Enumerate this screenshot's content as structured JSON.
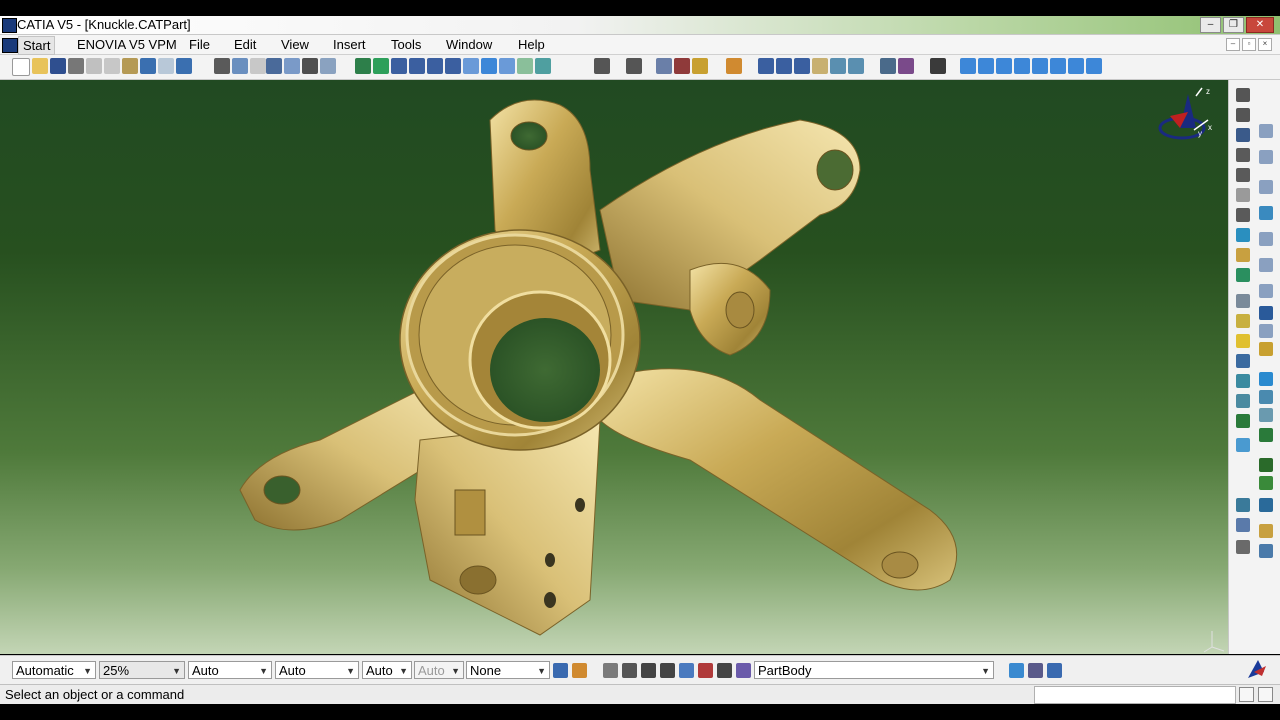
{
  "window": {
    "title": "CATIA V5 - [Knuckle.CATPart]",
    "buttons": {
      "minimize": "–",
      "restore": "❐",
      "close": "✕"
    }
  },
  "menubar": {
    "items": [
      "Start",
      "ENOVIA V5 VPM",
      "File",
      "Edit",
      "View",
      "Insert",
      "Tools",
      "Window",
      "Help"
    ],
    "mdi_buttons": [
      "–",
      "▫",
      "×"
    ]
  },
  "viewport": {
    "background_top": "#214a22",
    "background_bottom": "#c3d5b5",
    "part_color": "#c8aa55",
    "compass_axes": [
      "x",
      "y",
      "z"
    ]
  },
  "bottom_toolbar": {
    "combos": [
      {
        "label": "Automatic",
        "disabled": false
      },
      {
        "label": "25%",
        "disabled": false
      },
      {
        "label": "Auto",
        "disabled": false
      },
      {
        "label": "Auto",
        "disabled": false
      },
      {
        "label": "Auto",
        "disabled": false
      },
      {
        "label": "Auto",
        "disabled": true
      },
      {
        "label": "None",
        "disabled": false
      }
    ],
    "body_select": "PartBody"
  },
  "statusbar": {
    "text": "Select an object or a command"
  },
  "colors": {
    "accent": "#1a3a7a",
    "toolbar_bg": "#f3f3f3"
  }
}
